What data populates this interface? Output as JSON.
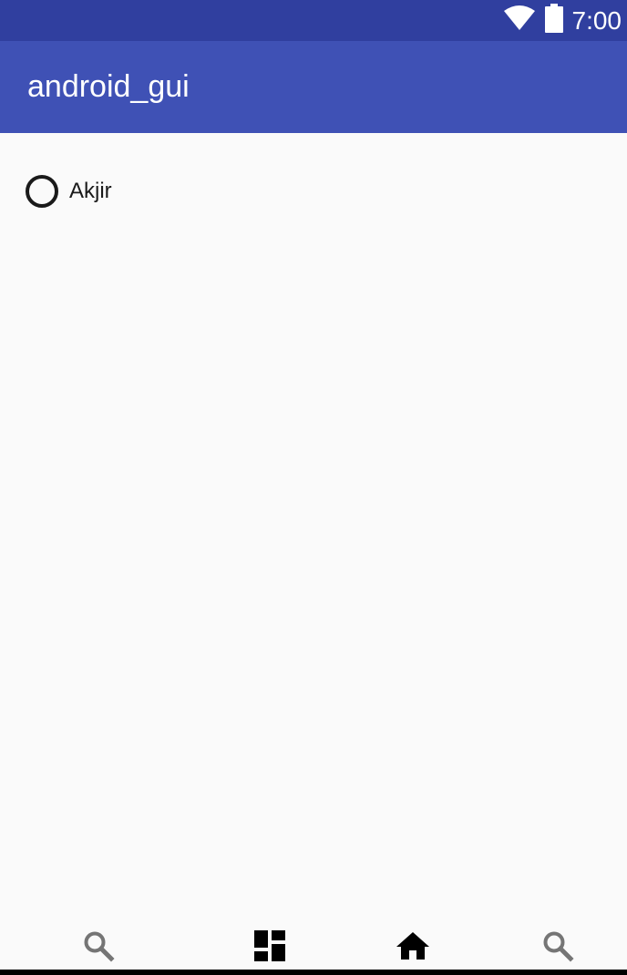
{
  "status_bar": {
    "time": "7:00",
    "icons": [
      "wifi-icon",
      "battery-icon"
    ],
    "color": "#303f9f"
  },
  "app_bar": {
    "title": "android_gui",
    "color": "#3f51b5"
  },
  "radio_options": [
    {
      "label": "Akjir",
      "checked": false
    }
  ],
  "bottom_nav": {
    "items": [
      {
        "icon": "search-icon",
        "active": false
      },
      {
        "icon": "dashboard-icon",
        "active": true
      },
      {
        "icon": "home-icon",
        "active": true
      },
      {
        "icon": "search-icon",
        "active": false
      }
    ],
    "active_color": "#000000",
    "inactive_color": "#757575"
  }
}
